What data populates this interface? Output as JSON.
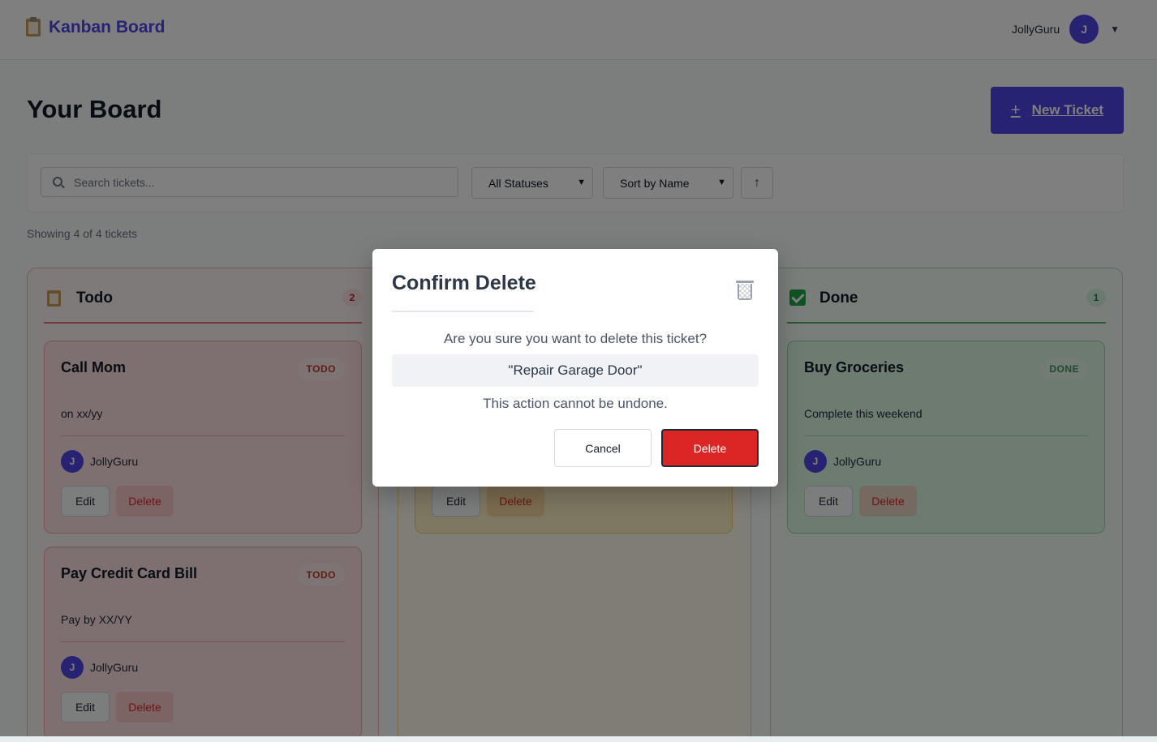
{
  "header": {
    "brand_title": "Kanban Board",
    "username": "JollyGuru",
    "avatar_initial": "J",
    "menu_caret": "▼"
  },
  "page": {
    "title": "Your Board",
    "new_ticket_icon": "+",
    "new_ticket_label": "New Ticket"
  },
  "filters": {
    "search_placeholder": "Search tickets...",
    "status_value": "All Statuses",
    "sort_value": "Sort by Name",
    "sort_direction": "↑"
  },
  "summary": "Showing 4 of 4 tickets",
  "columns": {
    "todo": {
      "title": "Todo",
      "count": "2",
      "cards": [
        {
          "title": "Call Mom",
          "badge": "TODO",
          "description": "on xx/yy",
          "user": "JollyGuru",
          "avatar": "J",
          "edit": "Edit",
          "delete": "Delete"
        },
        {
          "title": "Pay Credit Card Bill",
          "badge": "TODO",
          "description": "Pay by XX/YY",
          "user": "JollyGuru",
          "avatar": "J",
          "edit": "Edit",
          "delete": "Delete"
        }
      ]
    },
    "in_progress": {
      "cards": [
        {
          "edit": "Edit",
          "delete": "Delete"
        }
      ]
    },
    "done": {
      "title": "Done",
      "count": "1",
      "cards": [
        {
          "title": "Buy Groceries",
          "badge": "DONE",
          "description": "Complete this weekend",
          "user": "JollyGuru",
          "avatar": "J",
          "edit": "Edit",
          "delete": "Delete"
        }
      ]
    }
  },
  "modal": {
    "title": "Confirm Delete",
    "question": "Are you sure you want to delete this ticket?",
    "ticket_name": "\"Repair Garage Door\"",
    "warning": "This action cannot be undone.",
    "cancel_label": "Cancel",
    "delete_label": "Delete"
  },
  "colors": {
    "accent": "#4f46e5",
    "danger": "#dc2626",
    "todo": "#e57373",
    "done": "#52b36d"
  }
}
